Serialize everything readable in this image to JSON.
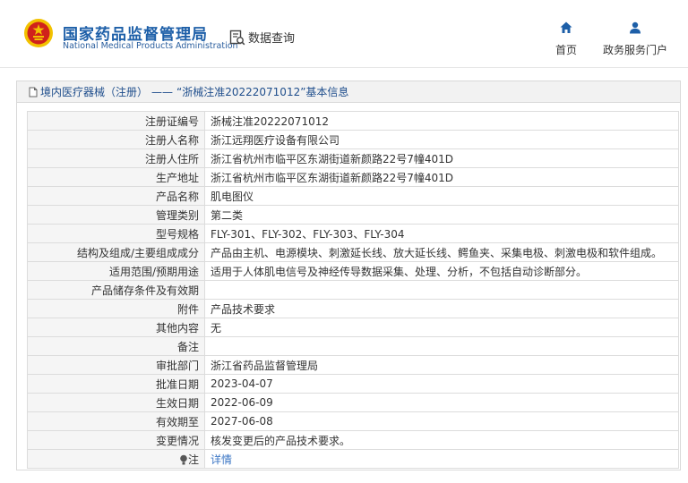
{
  "header": {
    "brand_cn": "国家药品监督管理局",
    "brand_en": "National Medical Products Administration",
    "data_query_label": "数据查询",
    "nav": {
      "home_label": "首页",
      "portal_label": "政务服务门户"
    },
    "icons": {
      "emblem": "national-emblem-icon",
      "data_query": "data-query-icon",
      "home": "home-icon",
      "portal": "user-icon"
    }
  },
  "panel": {
    "breadcrumb_category": "境内医疗器械（注册）",
    "breadcrumb_separator": "——",
    "breadcrumb_item": "“浙械注准20222071012”基本信息"
  },
  "record": {
    "rows": [
      {
        "label": "注册证编号",
        "value": "浙械注准20222071012"
      },
      {
        "label": "注册人名称",
        "value": "浙江远翔医疗设备有限公司"
      },
      {
        "label": "注册人住所",
        "value": "浙江省杭州市临平区东湖街道新颜路22号7幢401D"
      },
      {
        "label": "生产地址",
        "value": "浙江省杭州市临平区东湖街道新颜路22号7幢401D"
      },
      {
        "label": "产品名称",
        "value": "肌电图仪"
      },
      {
        "label": "管理类别",
        "value": "第二类"
      },
      {
        "label": "型号规格",
        "value": "FLY-301、FLY-302、FLY-303、FLY-304"
      },
      {
        "label": "结构及组成/主要组成成分",
        "value": "产品由主机、电源模块、刺激延长线、放大延长线、鳄鱼夹、采集电极、刺激电极和软件组成。"
      },
      {
        "label": "适用范围/预期用途",
        "value": "适用于人体肌电信号及神经传导数据采集、处理、分析，不包括自动诊断部分。"
      },
      {
        "label": "产品储存条件及有效期",
        "value": ""
      },
      {
        "label": "附件",
        "value": "产品技术要求"
      },
      {
        "label": "其他内容",
        "value": "无"
      },
      {
        "label": "备注",
        "value": ""
      },
      {
        "label": "审批部门",
        "value": "浙江省药品监督管理局"
      },
      {
        "label": "批准日期",
        "value": "2023-04-07"
      },
      {
        "label": "生效日期",
        "value": "2022-06-09"
      },
      {
        "label": "有效期至",
        "value": "2027-06-08"
      },
      {
        "label": "变更情况",
        "value": "核发变更后的产品技术要求。"
      }
    ],
    "note_label": "注",
    "note_link": "详情"
  },
  "colors": {
    "brand_blue": "#1d5fa8",
    "link_blue": "#3a75c4",
    "emblem_red": "#d0221b",
    "emblem_gold": "#f2c200"
  }
}
